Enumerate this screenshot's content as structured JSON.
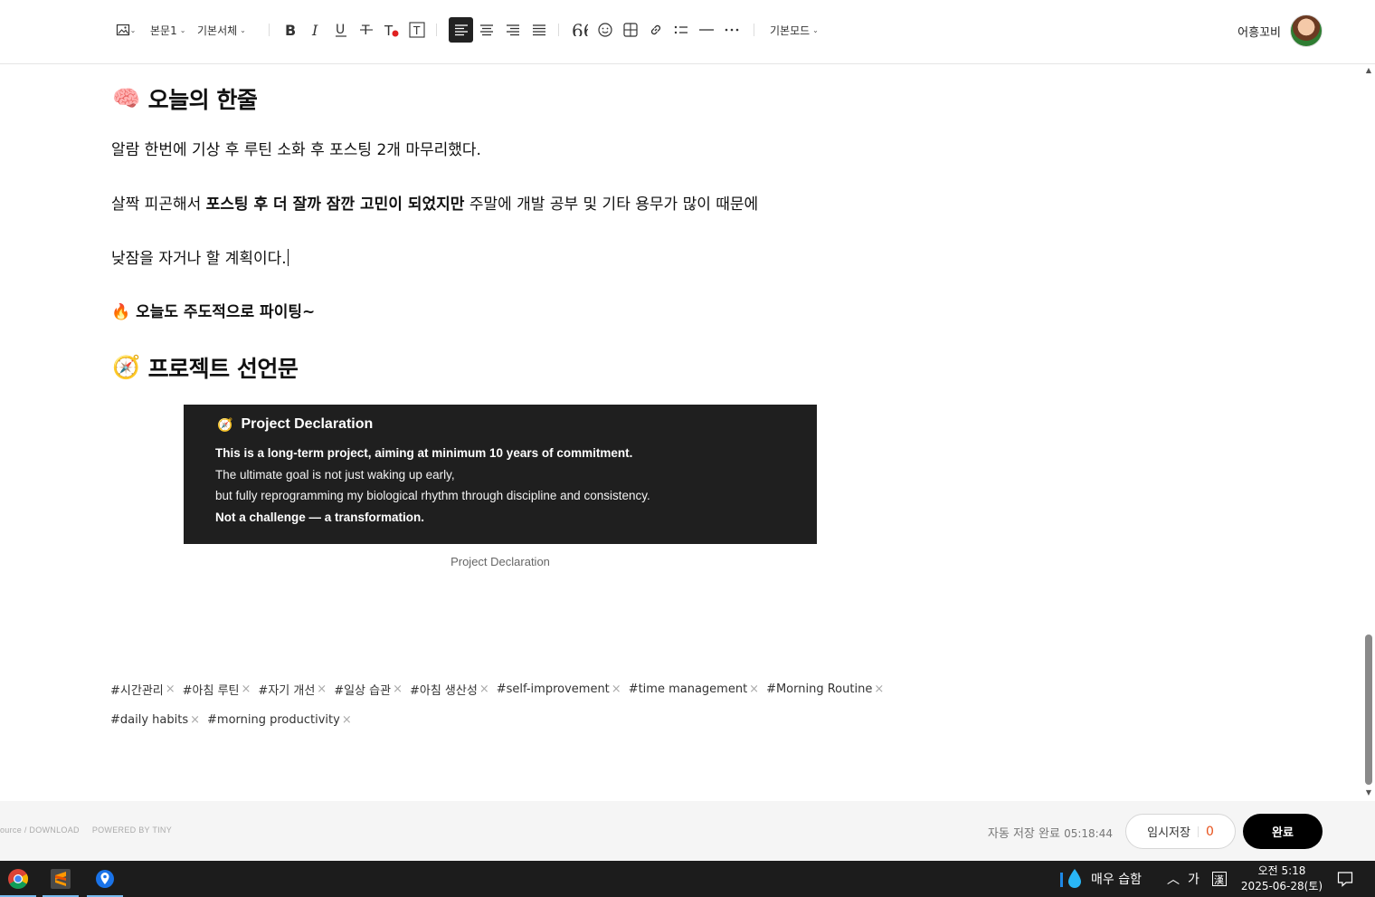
{
  "toolbar": {
    "paragraph_style": "본문1",
    "font_family": "기본서체",
    "mode": "기본모드",
    "user_name": "어흥꼬비"
  },
  "content": {
    "heading1": "오늘의 한줄",
    "heading1_emoji": "🧠",
    "p1": "알람 한번에 기상 후 루틴 소화 후 포스팅 2개 마무리했다.",
    "p2_before": "살짝 피곤해서 ",
    "p2_bold": "포스팅 후 더 잘까 잠깐 고민이 되었지만",
    "p2_after": " 주말에 개발 공부 및 기타 용무가 많이 때문에",
    "p3": "낮잠을 자거나 할 계획이다.",
    "p4_emoji": "🔥",
    "p4": "오늘도 주도적으로 파이팅~",
    "heading2": "프로젝트 선언문",
    "heading2_emoji": "🧭"
  },
  "declaration": {
    "emoji": "🧭",
    "title": "Project Declaration",
    "line1": "This is a long-term project, aiming at minimum 10 years of commitment.",
    "line2": "The ultimate goal is not just waking up early,",
    "line3": "but fully reprogramming my biological rhythm through discipline and consistency.",
    "line4": "Not a challenge — a transformation.",
    "caption": "Project Declaration"
  },
  "tags": {
    "row1": [
      "#시간관리",
      "#아침 루틴",
      "#자기 개선",
      "#일상 습관",
      "#아침 생산성",
      "#self-improvement",
      "#time management",
      "#Morning Routine"
    ],
    "row2": [
      "#daily habits",
      "#morning productivity"
    ]
  },
  "footer": {
    "left_text_1": "ource / DOWNLOAD",
    "left_text_2": "POWERED BY TINY",
    "autosave_label": "자동 저장 완료",
    "autosave_time": "05:18:44",
    "temp_save_label": "임시저장",
    "temp_save_count": "0",
    "done_label": "완료"
  },
  "taskbar": {
    "weather_text": "매우 습함",
    "ime": "가",
    "time": "오전 5:18",
    "date": "2025-06-28(토)"
  }
}
